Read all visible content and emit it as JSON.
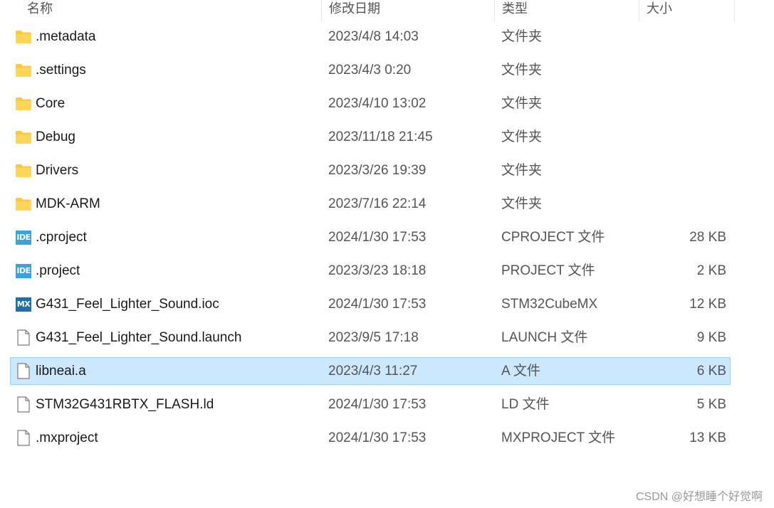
{
  "header": {
    "name": "名称",
    "date": "修改日期",
    "type": "类型",
    "size": "大小"
  },
  "files": [
    {
      "name": ".metadata",
      "date": "2023/4/8 14:03",
      "type": "文件夹",
      "size": "",
      "icon": "folder-icon"
    },
    {
      "name": ".settings",
      "date": "2023/4/3 0:20",
      "type": "文件夹",
      "size": "",
      "icon": "folder-icon"
    },
    {
      "name": "Core",
      "date": "2023/4/10 13:02",
      "type": "文件夹",
      "size": "",
      "icon": "folder-icon"
    },
    {
      "name": "Debug",
      "date": "2023/11/18 21:45",
      "type": "文件夹",
      "size": "",
      "icon": "folder-icon"
    },
    {
      "name": "Drivers",
      "date": "2023/3/26 19:39",
      "type": "文件夹",
      "size": "",
      "icon": "folder-icon"
    },
    {
      "name": "MDK-ARM",
      "date": "2023/7/16 22:14",
      "type": "文件夹",
      "size": "",
      "icon": "folder-icon"
    },
    {
      "name": ".cproject",
      "date": "2024/1/30 17:53",
      "type": "CPROJECT 文件",
      "size": "28 KB",
      "icon": "ide-file-icon"
    },
    {
      "name": ".project",
      "date": "2023/3/23 18:18",
      "type": "PROJECT 文件",
      "size": "2 KB",
      "icon": "ide-file-icon"
    },
    {
      "name": "G431_Feel_Lighter_Sound.ioc",
      "date": "2024/1/30 17:53",
      "type": "STM32CubeMX",
      "size": "12 KB",
      "icon": "mx-file-icon"
    },
    {
      "name": "G431_Feel_Lighter_Sound.launch",
      "date": "2023/9/5 17:18",
      "type": "LAUNCH 文件",
      "size": "9 KB",
      "icon": "document-icon"
    },
    {
      "name": "libneai.a",
      "date": "2023/4/3 11:27",
      "type": "A 文件",
      "size": "6 KB",
      "icon": "document-icon",
      "selected": true
    },
    {
      "name": "STM32G431RBTX_FLASH.ld",
      "date": "2024/1/30 17:53",
      "type": "LD 文件",
      "size": "5 KB",
      "icon": "document-icon"
    },
    {
      "name": ".mxproject",
      "date": "2024/1/30 17:53",
      "type": "MXPROJECT 文件",
      "size": "13 KB",
      "icon": "document-icon"
    }
  ],
  "icon_labels": {
    "ide": "IDE",
    "mx": "MX"
  },
  "watermark": "CSDN @好想睡个好觉啊",
  "colors": {
    "selection_bg": "#cce8ff",
    "selection_border": "#99d1ff",
    "folder": "#ffc83d",
    "ide_badge": "#3aa3dc",
    "mx_badge": "#1f6fa8"
  }
}
